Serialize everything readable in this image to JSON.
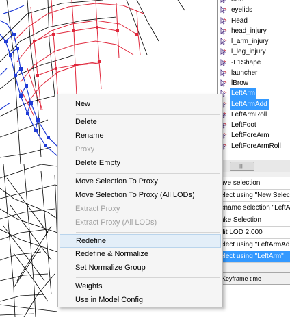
{
  "selection_tree": {
    "items": [
      {
        "label": "clan"
      },
      {
        "label": "eyelids"
      },
      {
        "label": "Head"
      },
      {
        "label": "head_injury"
      },
      {
        "label": "l_arm_injury"
      },
      {
        "label": "l_leg_injury"
      },
      {
        "label": "-L1Shape"
      },
      {
        "label": "launcher"
      },
      {
        "label": "lBrow"
      },
      {
        "label": "LeftArm",
        "selected": true
      },
      {
        "label": "LeftArmAdd",
        "selected": true
      },
      {
        "label": "LeftArmRoll"
      },
      {
        "label": "LeftFoot"
      },
      {
        "label": "LeftForeArm"
      },
      {
        "label": "LeftForeArmRoll"
      }
    ]
  },
  "scrollbar": {
    "thumb_label": "|||"
  },
  "history": {
    "rows": [
      {
        "label": "ave selection"
      },
      {
        "label": "elect using \"New Selec"
      },
      {
        "label": "ename selection \"LeftA"
      },
      {
        "label": "ake Selection"
      },
      {
        "label": "dit LOD   2.000"
      },
      {
        "label": "elect using \"LeftArmAd"
      },
      {
        "label": "elect using \"LeftArm\"",
        "selected": true
      }
    ]
  },
  "keyframe": {
    "header": "Keyframe time"
  },
  "context_menu": {
    "items": [
      {
        "label": "New",
        "disabled": false
      },
      {
        "label": "Delete",
        "disabled": false
      },
      {
        "label": "Rename",
        "disabled": false
      },
      {
        "label": "Proxy",
        "disabled": true
      },
      {
        "label": "Delete Empty",
        "disabled": false
      },
      {
        "label": "Move Selection To Proxy",
        "disabled": false
      },
      {
        "label": "Move Selection To Proxy (All LODs)",
        "disabled": false
      },
      {
        "label": "Extract Proxy",
        "disabled": true
      },
      {
        "label": "Extract Proxy (All LODs)",
        "disabled": true
      },
      {
        "label": "Redefine",
        "disabled": false,
        "highlighted": true
      },
      {
        "label": "Redefine & Normalize",
        "disabled": false
      },
      {
        "label": "Set Normalize Group",
        "disabled": false
      },
      {
        "label": "Weights",
        "disabled": false
      },
      {
        "label": "Use in Model Config",
        "disabled": false
      }
    ]
  },
  "colors": {
    "selection_blue": "#3399ff",
    "menu_highlight": "#e3eef8",
    "mesh_red": "#e0283c",
    "mesh_blue": "#1f3bd6",
    "mesh_black": "#000000"
  },
  "icons": {
    "tree_item_icon": "selection-arrow-icon"
  }
}
